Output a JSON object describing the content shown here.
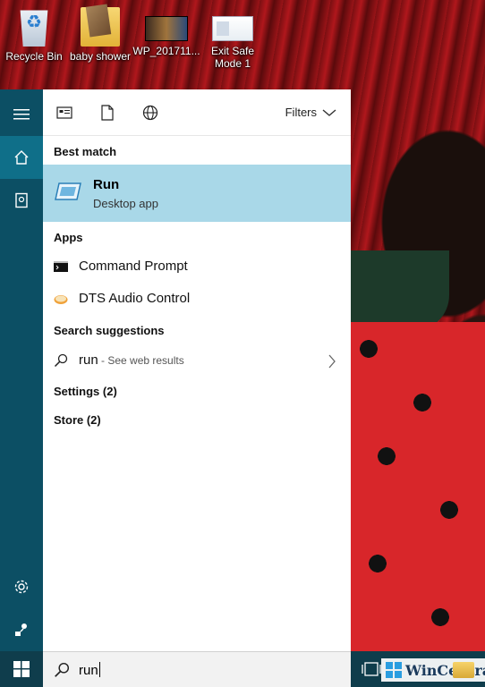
{
  "desktop": {
    "icons": [
      {
        "label": "Recycle Bin",
        "icon": "recycle-bin-icon"
      },
      {
        "label": "baby shower",
        "icon": "folder-icon"
      },
      {
        "label": "WP_201711...",
        "icon": "video-file-icon"
      },
      {
        "label": "Exit Safe Mode 1",
        "icon": "document-shortcut-icon"
      }
    ]
  },
  "start_menu": {
    "rail": {
      "items": [
        {
          "name": "menu",
          "icon": "hamburger-icon"
        },
        {
          "name": "home",
          "icon": "home-icon",
          "active": true
        },
        {
          "name": "notebook",
          "icon": "notebook-icon"
        },
        {
          "name": "settings",
          "icon": "gear-icon"
        },
        {
          "name": "feedback",
          "icon": "feedback-icon"
        }
      ]
    },
    "toolbar": {
      "scope_icons": [
        "apps-scope-icon",
        "documents-scope-icon",
        "web-scope-icon"
      ],
      "filters_label": "Filters"
    },
    "best_match": {
      "header": "Best match",
      "title": "Run",
      "subtitle": "Desktop app",
      "icon": "run-app-icon"
    },
    "apps": {
      "header": "Apps",
      "items": [
        {
          "label": "Command Prompt",
          "icon": "command-prompt-icon"
        },
        {
          "label": "DTS Audio Control",
          "icon": "dts-audio-icon"
        }
      ]
    },
    "suggestions": {
      "header": "Search suggestions",
      "query": "run",
      "hint": " - See web results"
    },
    "settings": {
      "label": "Settings (2)"
    },
    "store": {
      "label": "Store (2)"
    }
  },
  "taskbar": {
    "search_value": "run",
    "watermark": "WinCentral"
  },
  "colors": {
    "rail": "#0c4f64",
    "rail_active": "#0f6f89",
    "best_match_bg": "#a9d8e8",
    "taskbar": "#0f3d4c"
  }
}
